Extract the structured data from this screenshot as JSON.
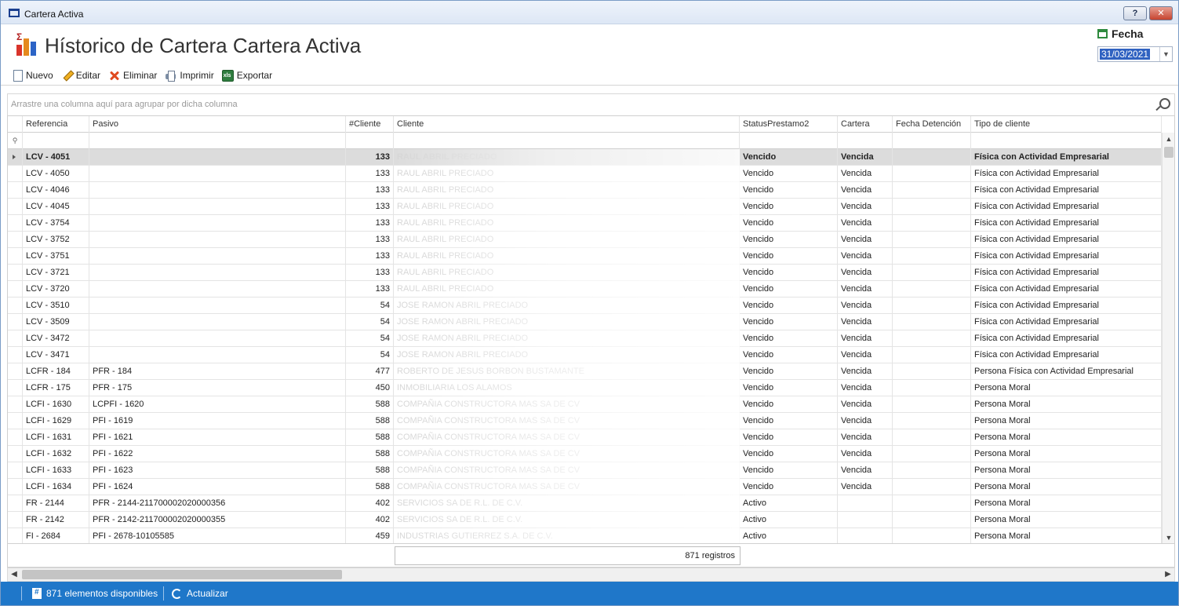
{
  "window": {
    "title": "Cartera Activa",
    "help": "?",
    "close": "✕"
  },
  "header": {
    "title": "Hístorico de Cartera Cartera Activa"
  },
  "toolbar": {
    "nuevo": "Nuevo",
    "editar": "Editar",
    "eliminar": "Eliminar",
    "imprimir": "Imprimir",
    "exportar": "Exportar"
  },
  "fecha": {
    "label": "Fecha",
    "value": "31/03/2021"
  },
  "group_hint": "Arrastre una columna aquí para agrupar por dicha columna",
  "columns": [
    "Referencia",
    "Pasivo",
    "#Cliente",
    "Cliente",
    "StatusPrestamo2",
    "Cartera",
    "Fecha Detención",
    "Tipo de cliente"
  ],
  "rows": [
    {
      "ref": "LCV - 4051",
      "pasivo": "",
      "num": "133",
      "cliente": "RAUL ABRIL PRECIADO",
      "status": "Vencido",
      "cartera": "Vencida",
      "fecha": "",
      "tipo": "Física con Actividad Empresarial"
    },
    {
      "ref": "LCV - 4050",
      "pasivo": "",
      "num": "133",
      "cliente": "RAUL ABRIL PRECIADO",
      "status": "Vencido",
      "cartera": "Vencida",
      "fecha": "",
      "tipo": "Física con Actividad Empresarial"
    },
    {
      "ref": "LCV - 4046",
      "pasivo": "",
      "num": "133",
      "cliente": "RAUL ABRIL PRECIADO",
      "status": "Vencido",
      "cartera": "Vencida",
      "fecha": "",
      "tipo": "Física con Actividad Empresarial"
    },
    {
      "ref": "LCV - 4045",
      "pasivo": "",
      "num": "133",
      "cliente": "RAUL ABRIL PRECIADO",
      "status": "Vencido",
      "cartera": "Vencida",
      "fecha": "",
      "tipo": "Física con Actividad Empresarial"
    },
    {
      "ref": "LCV - 3754",
      "pasivo": "",
      "num": "133",
      "cliente": "RAUL ABRIL PRECIADO",
      "status": "Vencido",
      "cartera": "Vencida",
      "fecha": "",
      "tipo": "Física con Actividad Empresarial"
    },
    {
      "ref": "LCV - 3752",
      "pasivo": "",
      "num": "133",
      "cliente": "RAUL ABRIL PRECIADO",
      "status": "Vencido",
      "cartera": "Vencida",
      "fecha": "",
      "tipo": "Física con Actividad Empresarial"
    },
    {
      "ref": "LCV - 3751",
      "pasivo": "",
      "num": "133",
      "cliente": "RAUL ABRIL PRECIADO",
      "status": "Vencido",
      "cartera": "Vencida",
      "fecha": "",
      "tipo": "Física con Actividad Empresarial"
    },
    {
      "ref": "LCV - 3721",
      "pasivo": "",
      "num": "133",
      "cliente": "RAUL ABRIL PRECIADO",
      "status": "Vencido",
      "cartera": "Vencida",
      "fecha": "",
      "tipo": "Física con Actividad Empresarial"
    },
    {
      "ref": "LCV - 3720",
      "pasivo": "",
      "num": "133",
      "cliente": "RAUL ABRIL PRECIADO",
      "status": "Vencido",
      "cartera": "Vencida",
      "fecha": "",
      "tipo": "Física con Actividad Empresarial"
    },
    {
      "ref": "LCV - 3510",
      "pasivo": "",
      "num": "54",
      "cliente": "JOSE RAMON ABRIL PRECIADO",
      "status": "Vencido",
      "cartera": "Vencida",
      "fecha": "",
      "tipo": "Física con Actividad Empresarial"
    },
    {
      "ref": "LCV - 3509",
      "pasivo": "",
      "num": "54",
      "cliente": "JOSE RAMON ABRIL PRECIADO",
      "status": "Vencido",
      "cartera": "Vencida",
      "fecha": "",
      "tipo": "Física con Actividad Empresarial"
    },
    {
      "ref": "LCV - 3472",
      "pasivo": "",
      "num": "54",
      "cliente": "JOSE RAMON ABRIL PRECIADO",
      "status": "Vencido",
      "cartera": "Vencida",
      "fecha": "",
      "tipo": "Física con Actividad Empresarial"
    },
    {
      "ref": "LCV - 3471",
      "pasivo": "",
      "num": "54",
      "cliente": "JOSE RAMON ABRIL PRECIADO",
      "status": "Vencido",
      "cartera": "Vencida",
      "fecha": "",
      "tipo": "Física con Actividad Empresarial"
    },
    {
      "ref": "LCFR - 184",
      "pasivo": "PFR - 184",
      "num": "477",
      "cliente": "ROBERTO DE JESUS BORBON BUSTAMANTE",
      "status": "Vencido",
      "cartera": "Vencida",
      "fecha": "",
      "tipo": "Persona Física con Actividad Empresarial"
    },
    {
      "ref": "LCFR - 175",
      "pasivo": "PFR - 175",
      "num": "450",
      "cliente": "INMOBILIARIA LOS ALAMOS",
      "status": "Vencido",
      "cartera": "Vencida",
      "fecha": "",
      "tipo": "Persona Moral"
    },
    {
      "ref": "LCFI - 1630",
      "pasivo": "LCPFI - 1620",
      "num": "588",
      "cliente": "COMPAÑIA CONSTRUCTORA MAS SA DE CV",
      "status": "Vencido",
      "cartera": "Vencida",
      "fecha": "",
      "tipo": "Persona Moral"
    },
    {
      "ref": "LCFI - 1629",
      "pasivo": "PFI - 1619",
      "num": "588",
      "cliente": "COMPAÑIA CONSTRUCTORA MAS SA DE CV",
      "status": "Vencido",
      "cartera": "Vencida",
      "fecha": "",
      "tipo": "Persona Moral"
    },
    {
      "ref": "LCFI - 1631",
      "pasivo": "PFI - 1621",
      "num": "588",
      "cliente": "COMPAÑIA CONSTRUCTORA MAS SA DE CV",
      "status": "Vencido",
      "cartera": "Vencida",
      "fecha": "",
      "tipo": "Persona Moral"
    },
    {
      "ref": "LCFI - 1632",
      "pasivo": "PFI - 1622",
      "num": "588",
      "cliente": "COMPAÑIA CONSTRUCTORA MAS SA DE CV",
      "status": "Vencido",
      "cartera": "Vencida",
      "fecha": "",
      "tipo": "Persona Moral"
    },
    {
      "ref": "LCFI - 1633",
      "pasivo": "PFI - 1623",
      "num": "588",
      "cliente": "COMPAÑIA CONSTRUCTORA MAS SA DE CV",
      "status": "Vencido",
      "cartera": "Vencida",
      "fecha": "",
      "tipo": "Persona Moral"
    },
    {
      "ref": "LCFI - 1634",
      "pasivo": "PFI - 1624",
      "num": "588",
      "cliente": "COMPAÑIA CONSTRUCTORA MAS SA DE CV",
      "status": "Vencido",
      "cartera": "Vencida",
      "fecha": "",
      "tipo": "Persona Moral"
    },
    {
      "ref": "FR - 2144",
      "pasivo": "PFR - 2144-211700002020000356",
      "num": "402",
      "cliente": "SERVICIOS SA DE R.L. DE C.V.",
      "status": "Activo",
      "cartera": "",
      "fecha": "",
      "tipo": "Persona Moral"
    },
    {
      "ref": "FR - 2142",
      "pasivo": "PFR - 2142-211700002020000355",
      "num": "402",
      "cliente": "SERVICIOS SA DE R.L. DE C.V.",
      "status": "Activo",
      "cartera": "",
      "fecha": "",
      "tipo": "Persona Moral"
    },
    {
      "ref": "FI - 2684",
      "pasivo": "PFI - 2678-10105585",
      "num": "459",
      "cliente": "INDUSTRIAS GUTIERREZ S.A. DE C.V.",
      "status": "Activo",
      "cartera": "",
      "fecha": "",
      "tipo": "Persona Moral"
    }
  ],
  "summary": "871 registros",
  "status": {
    "available": "871 elementos disponibles",
    "refresh": "Actualizar"
  },
  "colors": {
    "statusbar": "#1f77c9",
    "selection": "#3062c1",
    "selected_row": "#dcdcdc"
  }
}
